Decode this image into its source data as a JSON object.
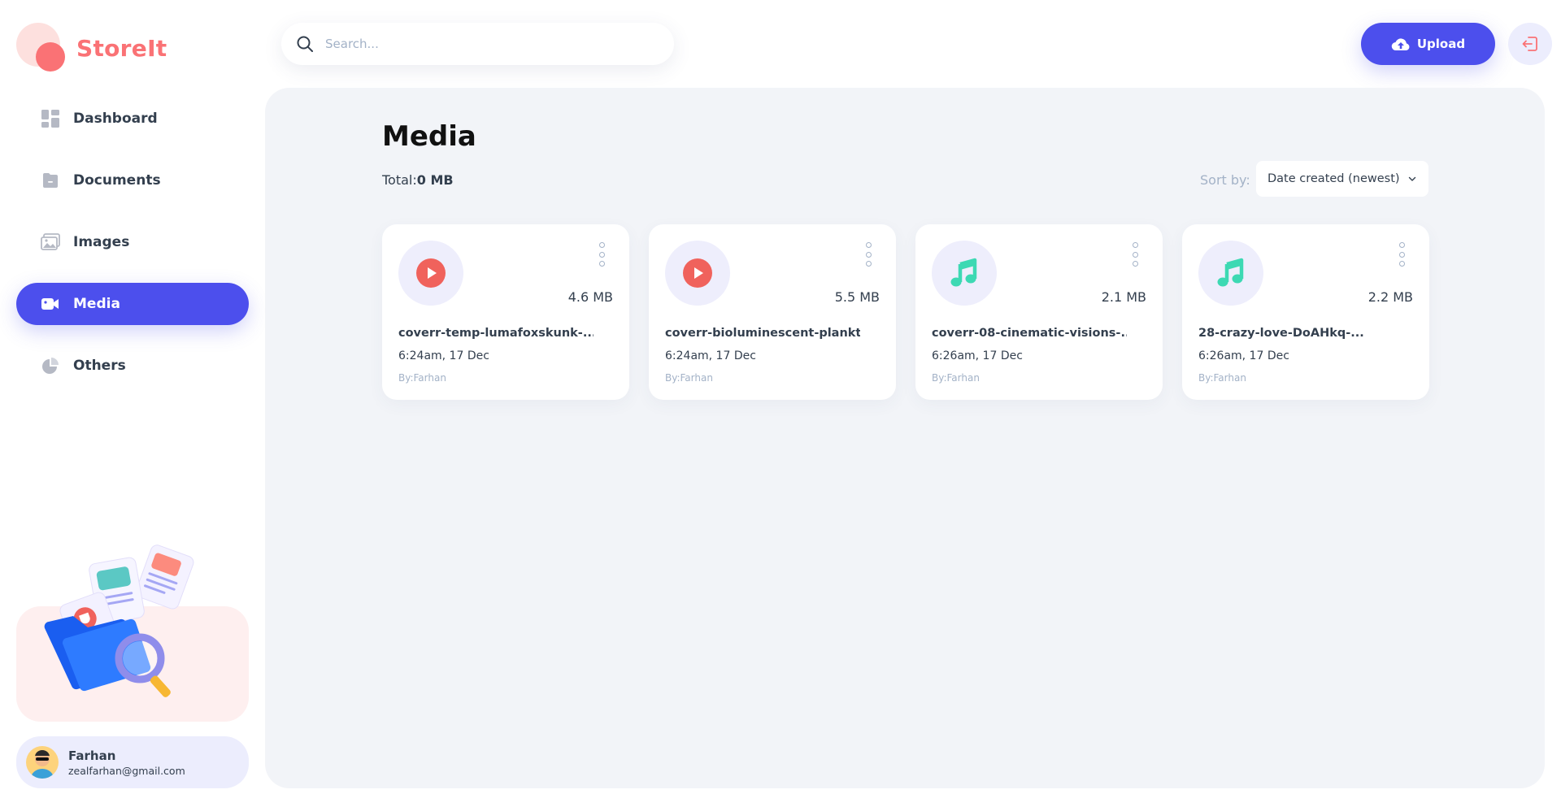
{
  "app": {
    "name": "StoreIt",
    "brand_color": "#FA7275",
    "accent_color": "#4C4FED"
  },
  "sidebar": {
    "items": [
      {
        "label": "Dashboard",
        "icon": "dashboard-icon",
        "active": false
      },
      {
        "label": "Documents",
        "icon": "documents-icon",
        "active": false
      },
      {
        "label": "Images",
        "icon": "images-icon",
        "active": false
      },
      {
        "label": "Media",
        "icon": "video-icon",
        "active": true
      },
      {
        "label": "Others",
        "icon": "pie-chart-icon",
        "active": false
      }
    ],
    "user": {
      "name": "Farhan",
      "email": "zealfarhan@gmail.com"
    }
  },
  "header": {
    "search_placeholder": "Search...",
    "upload_label": "Upload",
    "upload_icon": "cloud-upload-icon",
    "logout_icon": "logout-icon"
  },
  "main": {
    "title": "Media",
    "total_label": "Total:",
    "total_value": "0 MB",
    "sort_label": "Sort by:",
    "sort_value": "Date created (newest)",
    "files": [
      {
        "name": "coverr-temp-lumafoxskunk-...",
        "size": "4.6 MB",
        "date": "6:24am, 17 Dec",
        "owner": "By:Farhan",
        "kind": "video",
        "icon": "play-icon"
      },
      {
        "name": "coverr-bioluminescent-plankton-...",
        "size": "5.5 MB",
        "date": "6:24am, 17 Dec",
        "owner": "By:Farhan",
        "kind": "video",
        "icon": "play-icon"
      },
      {
        "name": "coverr-08-cinematic-visions-...",
        "size": "2.1 MB",
        "date": "6:26am, 17 Dec",
        "owner": "By:Farhan",
        "kind": "audio",
        "icon": "music-note-icon"
      },
      {
        "name": "28-crazy-love-DoAHkq-...",
        "size": "2.2 MB",
        "date": "6:26am, 17 Dec",
        "owner": "By:Farhan",
        "kind": "audio",
        "icon": "music-note-icon"
      }
    ]
  }
}
